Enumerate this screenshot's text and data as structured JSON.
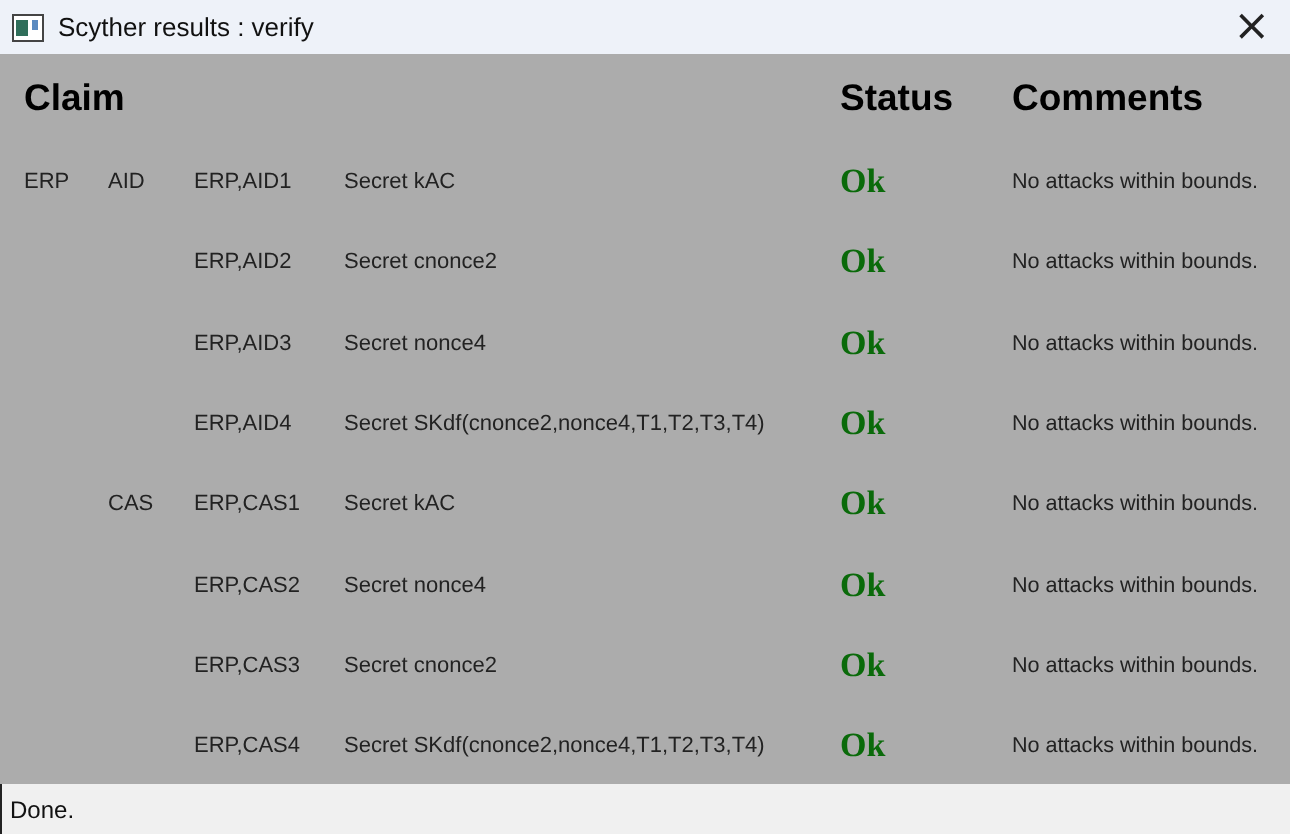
{
  "window": {
    "title": "Scyther results : verify",
    "close": "×"
  },
  "table": {
    "columns": [
      "Claim",
      "Status",
      "Comments"
    ],
    "rows": [
      {
        "protocol": "ERP",
        "role": "AID",
        "claim": "ERP,AID1",
        "description": "Secret kAC",
        "status": "Ok",
        "comment": "No attacks within bounds."
      },
      {
        "claim": "ERP,AID2",
        "description": "Secret cnonce2",
        "status": "Ok",
        "comment": "No attacks within bounds."
      },
      {
        "claim": "ERP,AID3",
        "description": "Secret nonce4",
        "status": "Ok",
        "comment": "No attacks within bounds."
      },
      {
        "claim": "ERP,AID4",
        "description": "Secret SKdf(cnonce2,nonce4,T1,T2,T3,T4)",
        "status": "Ok",
        "comment": "No attacks within bounds."
      },
      {
        "role": "CAS",
        "claim": "ERP,CAS1",
        "description": "Secret kAC",
        "status": "Ok",
        "comment": "No attacks within bounds."
      },
      {
        "claim": "ERP,CAS2",
        "description": "Secret nonce4",
        "status": "Ok",
        "comment": "No attacks within bounds."
      },
      {
        "claim": "ERP,CAS3",
        "description": "Secret cnonce2",
        "status": "Ok",
        "comment": "No attacks within bounds."
      },
      {
        "claim": "ERP,CAS4",
        "description": "Secret SKdf(cnonce2,nonce4,T1,T2,T3,T4)",
        "status": "Ok",
        "comment": "No attacks within bounds."
      }
    ]
  },
  "status_bar": "Done."
}
